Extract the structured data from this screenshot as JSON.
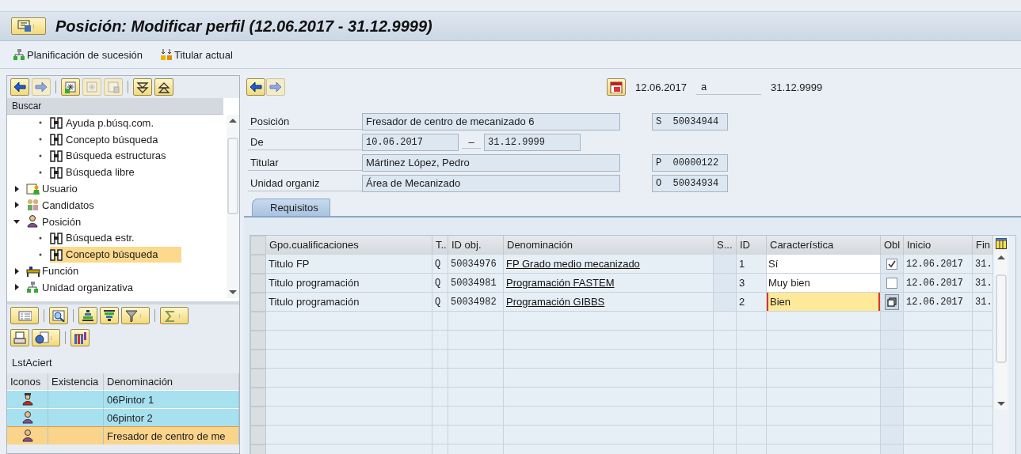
{
  "window": {
    "title": "Posición: Modificar perfil (12.06.2017 - 31.12.9999)"
  },
  "toolbar": [
    {
      "kind": "org",
      "label": "Planificación de sucesión"
    },
    {
      "kind": "holder",
      "label": "Titular actual"
    }
  ],
  "left_toolbar": [
    {
      "kind": "back",
      "disabled": false
    },
    {
      "kind": "forward",
      "disabled": true
    },
    {
      "kind": "create",
      "disabled": false
    },
    {
      "kind": "copy",
      "disabled": true
    },
    {
      "kind": "delete",
      "disabled": true
    },
    {
      "kind": "expand",
      "disabled": false
    },
    {
      "kind": "collapse",
      "disabled": false
    }
  ],
  "tree": {
    "header": "Buscar",
    "continued_children": [
      {
        "label": "Ayuda p.búsq.com.",
        "kind": "search",
        "selected": false
      },
      {
        "label": "Concepto búsqueda",
        "kind": "search",
        "selected": false
      },
      {
        "label": "Búsqueda estructuras",
        "kind": "search",
        "selected": false
      },
      {
        "label": "Búsqueda libre",
        "kind": "search",
        "selected": false
      }
    ],
    "items": [
      {
        "label": "Usuario",
        "kind": "user",
        "expanded": false,
        "selected": false
      },
      {
        "label": "Candidatos",
        "kind": "group",
        "expanded": false,
        "selected": false
      },
      {
        "label": "Posición",
        "kind": "person",
        "expanded": true,
        "selected": false,
        "children": [
          {
            "label": "Búsqueda estr.",
            "kind": "search",
            "selected": false
          },
          {
            "label": "Concepto búsqueda",
            "kind": "search",
            "selected": true
          }
        ]
      },
      {
        "label": "Función",
        "kind": "job",
        "expanded": false,
        "selected": false
      },
      {
        "label": "Unidad organizativa",
        "kind": "org",
        "expanded": false,
        "selected": false
      }
    ]
  },
  "alv_toolbar_1": [
    {
      "kind": "details",
      "menu": false
    },
    {
      "kind": "find",
      "menu": false
    },
    {
      "kind": "sort_up",
      "menu": false
    },
    {
      "kind": "sort_down",
      "menu": false
    },
    {
      "kind": "filter",
      "menu": true
    },
    {
      "kind": "sum",
      "menu": true
    }
  ],
  "alv_toolbar_2": [
    {
      "kind": "print",
      "menu": false
    },
    {
      "kind": "export",
      "menu": true
    },
    {
      "kind": "layout",
      "menu": false
    }
  ],
  "hit_list": {
    "title": "LstAciert",
    "columns": [
      "Iconos",
      "Existencia",
      "Denominación"
    ],
    "rows": [
      {
        "kind": "holder",
        "denominacion": "06Pintor 1",
        "selected": false
      },
      {
        "kind": "position",
        "denominacion": "06pintor 2",
        "selected": false
      },
      {
        "kind": "position",
        "denominacion": "Fresador de centro de me",
        "selected": true
      }
    ]
  },
  "nav": [
    {
      "kind": "back",
      "disabled": false
    },
    {
      "kind": "forward",
      "disabled": true
    }
  ],
  "period": {
    "from": "12.06.2017",
    "separator": "a",
    "to": "31.12.9999"
  },
  "header_fields": [
    {
      "kind": "text",
      "label": "Posición",
      "value": "Fresador de centro de mecanizado 6",
      "code": "S  50034944"
    },
    {
      "kind": "range",
      "label": "De",
      "from": "10.06.2017",
      "separator": "–",
      "to": "31.12.9999"
    },
    {
      "kind": "text",
      "label": "Titular",
      "value": "Mártinez López, Pedro",
      "code": "P  00000122"
    },
    {
      "kind": "text",
      "label": "Unidad organiz",
      "value": "Área de Mecanizado",
      "code": "O  50034934"
    }
  ],
  "tabs": [
    {
      "label": "Requisitos",
      "selected": true
    }
  ],
  "table": {
    "columns": [
      "Gpo.cualificaciones",
      "T..",
      "ID obj.",
      "Denominación",
      "S...",
      "ID",
      "Característica",
      "Obl",
      "Inicio",
      "Fin"
    ],
    "rows": [
      {
        "gpo": "Titulo FP",
        "t": "Q",
        "id_obj": "50034976",
        "denominacion": "FP Grado medio mecanizado",
        "id": "1",
        "caracteristica": "Sí",
        "focused": false,
        "value_help": false,
        "obl_checked": true,
        "inicio": "12.06.2017",
        "fin": "31."
      },
      {
        "gpo": "Titulo programación",
        "t": "Q",
        "id_obj": "50034981",
        "denominacion": "Programación FASTEM",
        "id": "3",
        "caracteristica": "Muy bien",
        "focused": false,
        "value_help": false,
        "obl_checked": false,
        "inicio": "12.06.2017",
        "fin": "31."
      },
      {
        "gpo": "Titulo programación",
        "t": "Q",
        "id_obj": "50034982",
        "denominacion": "Programación GIBBS",
        "id": "2",
        "caracteristica": "Bien",
        "focused": true,
        "value_help": true,
        "inicio": "12.06.2017",
        "fin": "31."
      }
    ]
  }
}
